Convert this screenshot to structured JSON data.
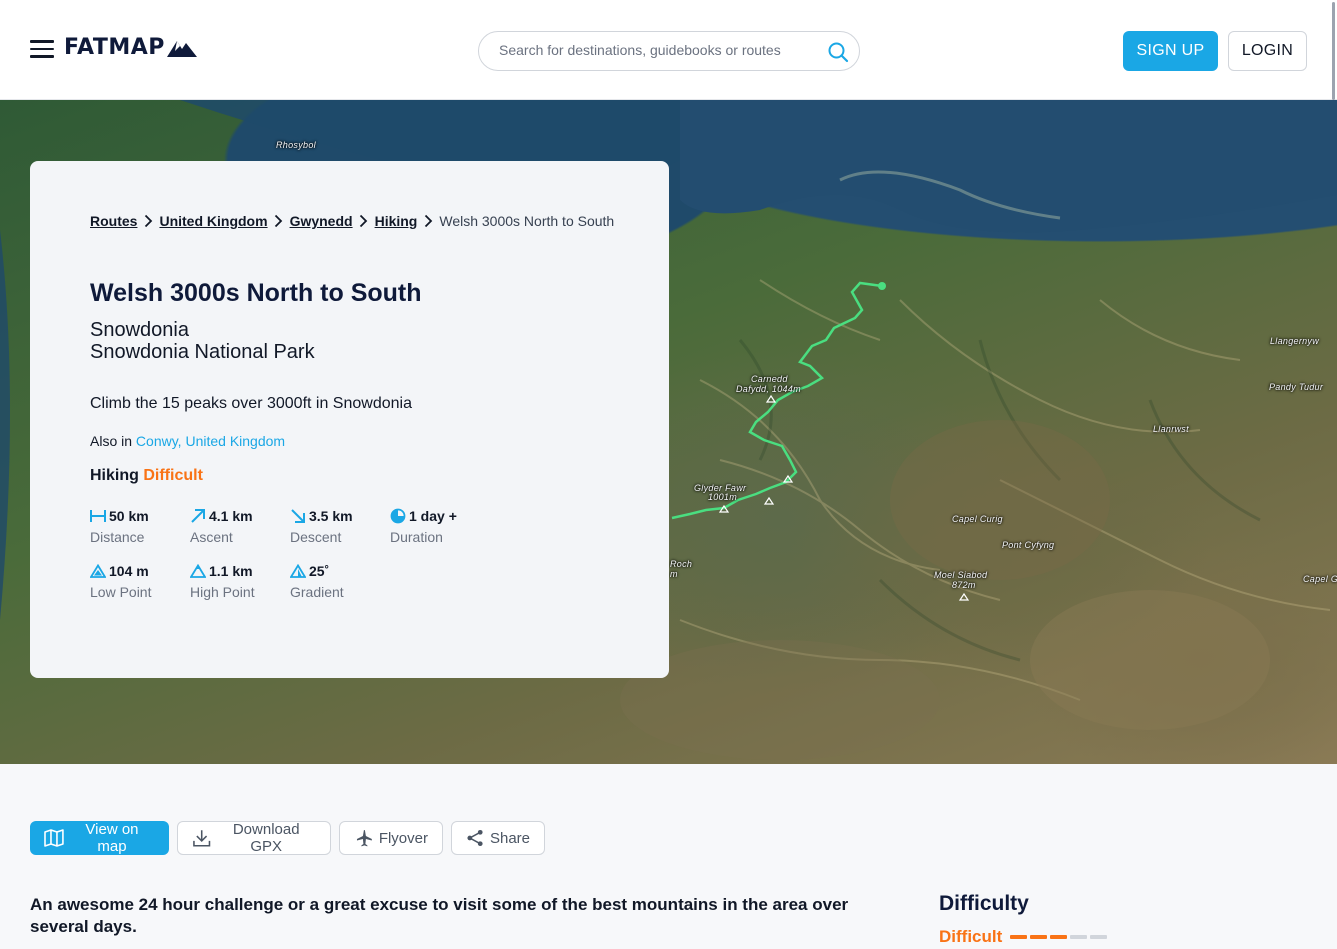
{
  "header": {
    "logo_text": "FATMAP",
    "search_placeholder": "Search for destinations, guidebooks or routes",
    "signup_label": "SIGN UP",
    "login_label": "LOGIN"
  },
  "map": {
    "places": [
      {
        "name": "Rhosybol"
      },
      {
        "name": "Llangernyw"
      },
      {
        "name": "Pandy Tudur"
      },
      {
        "name": "Llanrwst"
      },
      {
        "name": "Carnedd"
      },
      {
        "name": "Dafydd, 1044m"
      },
      {
        "name": "Glyder Fawr"
      },
      {
        "name": "1001m"
      },
      {
        "name": "Capel Curig"
      },
      {
        "name": "Pont Cyfyng"
      },
      {
        "name": "Moel Siabod"
      },
      {
        "name": "872m"
      },
      {
        "name": "Capel G"
      },
      {
        "name": "Roch"
      },
      {
        "name": "m"
      }
    ],
    "route_color": "#4ade80"
  },
  "route": {
    "breadcrumb": [
      "Routes",
      "United Kingdom",
      "Gwynedd",
      "Hiking"
    ],
    "breadcrumb_current": "Welsh 3000s North to South",
    "title": "Welsh 3000s North to South",
    "region": "Snowdonia",
    "park": "Snowdonia National Park",
    "description": "Climb the 15 peaks over 3000ft in Snowdonia",
    "also_in_label": "Also in",
    "also_in_value": "Conwy, United Kingdom",
    "activity": "Hiking",
    "difficulty": "Difficult",
    "stats": {
      "distance": {
        "value": "50 km",
        "label": "Distance"
      },
      "ascent": {
        "value": "4.1 km",
        "label": "Ascent"
      },
      "descent": {
        "value": "3.5 km",
        "label": "Descent"
      },
      "duration": {
        "value": "1 day +",
        "label": "Duration"
      },
      "low_point": {
        "value": "104 m",
        "label": "Low Point"
      },
      "high_point": {
        "value": "1.1 km",
        "label": "High Point"
      },
      "gradient": {
        "value": "25˚",
        "label": "Gradient"
      }
    }
  },
  "actions": {
    "view_on_map": "View on map",
    "download_gpx": "Download GPX",
    "flyover": "Flyover",
    "share": "Share"
  },
  "overview": {
    "lead": "An awesome 24 hour challenge or a great excuse to visit some of the best mountains in the area over several days."
  },
  "difficulty_panel": {
    "heading": "Difficulty",
    "value": "Difficult",
    "level": 3,
    "max_level": 5
  },
  "colors": {
    "accent": "#1aa7e5",
    "difficulty": "#f97316",
    "bar_inactive": "#d1d5db"
  }
}
